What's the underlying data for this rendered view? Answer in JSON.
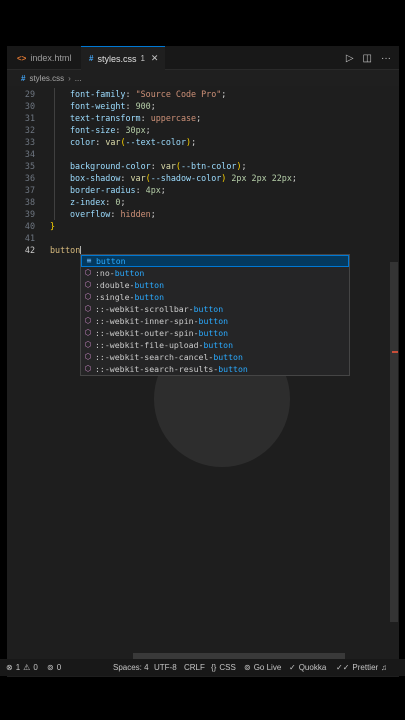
{
  "tabs": [
    {
      "label": "index.html",
      "icon": "html-icon",
      "active": false
    },
    {
      "label": "styles.css",
      "icon": "css-icon",
      "active": true,
      "problems": "1"
    }
  ],
  "breadcrumb": {
    "file": "styles.css",
    "symbol": "..."
  },
  "code_lines": [
    {
      "n": "29",
      "tokens": [
        [
          "p",
          "font-family"
        ],
        [
          "w",
          ": "
        ],
        [
          "v",
          "\"Source Code Pro\""
        ],
        [
          "w",
          ";"
        ]
      ]
    },
    {
      "n": "30",
      "tokens": [
        [
          "p",
          "font-weight"
        ],
        [
          "w",
          ": "
        ],
        [
          "n",
          "900"
        ],
        [
          "w",
          ";"
        ]
      ]
    },
    {
      "n": "31",
      "tokens": [
        [
          "p",
          "text-transform"
        ],
        [
          "w",
          ": "
        ],
        [
          "v",
          "uppercase"
        ],
        [
          "w",
          ";"
        ]
      ]
    },
    {
      "n": "32",
      "tokens": [
        [
          "p",
          "font-size"
        ],
        [
          "w",
          ": "
        ],
        [
          "n",
          "30px"
        ],
        [
          "w",
          ";"
        ]
      ]
    },
    {
      "n": "33",
      "tokens": [
        [
          "p",
          "color"
        ],
        [
          "w",
          ": "
        ],
        [
          "f",
          "var"
        ],
        [
          "b",
          "("
        ],
        [
          "p",
          "--text-color"
        ],
        [
          "b",
          ")"
        ],
        [
          "w",
          ";"
        ]
      ]
    },
    {
      "n": "34",
      "tokens": []
    },
    {
      "n": "35",
      "tokens": [
        [
          "p",
          "background-color"
        ],
        [
          "w",
          ": "
        ],
        [
          "f",
          "var"
        ],
        [
          "b",
          "("
        ],
        [
          "p",
          "--btn-color"
        ],
        [
          "b",
          ")"
        ],
        [
          "w",
          ";"
        ]
      ]
    },
    {
      "n": "36",
      "tokens": [
        [
          "p",
          "box-shadow"
        ],
        [
          "w",
          ": "
        ],
        [
          "f",
          "var"
        ],
        [
          "b",
          "("
        ],
        [
          "p",
          "--shadow-color"
        ],
        [
          "b",
          ")"
        ],
        [
          "w",
          " "
        ],
        [
          "n",
          "2px 2px 22px"
        ],
        [
          "w",
          ";"
        ]
      ]
    },
    {
      "n": "37",
      "tokens": [
        [
          "p",
          "border-radius"
        ],
        [
          "w",
          ": "
        ],
        [
          "n",
          "4px"
        ],
        [
          "w",
          ";"
        ]
      ]
    },
    {
      "n": "38",
      "tokens": [
        [
          "p",
          "z-index"
        ],
        [
          "w",
          ": "
        ],
        [
          "n",
          "0"
        ],
        [
          "w",
          ";"
        ]
      ]
    },
    {
      "n": "39",
      "tokens": [
        [
          "p",
          "overflow"
        ],
        [
          "w",
          ": "
        ],
        [
          "v",
          "hidden"
        ],
        [
          "w",
          ";"
        ]
      ]
    },
    {
      "n": "40",
      "tokens": [
        [
          "b",
          "}"
        ]
      ]
    },
    {
      "n": "41",
      "tokens": []
    },
    {
      "n": "42",
      "tokens": [
        [
          "sel",
          "button"
        ]
      ]
    }
  ],
  "suggestions": [
    {
      "pre": "",
      "match": "button",
      "post": ""
    },
    {
      "pre": ":no-",
      "match": "button",
      "post": ""
    },
    {
      "pre": ":double-",
      "match": "button",
      "post": ""
    },
    {
      "pre": ":single-",
      "match": "button",
      "post": ""
    },
    {
      "pre": "::-webkit-scrollbar-",
      "match": "button",
      "post": ""
    },
    {
      "pre": "::-webkit-inner-spin-",
      "match": "button",
      "post": ""
    },
    {
      "pre": "::-webkit-outer-spin-",
      "match": "button",
      "post": ""
    },
    {
      "pre": "::-webkit-file-upload-",
      "match": "button",
      "post": ""
    },
    {
      "pre": "::-webkit-search-cancel-",
      "match": "button",
      "post": ""
    },
    {
      "pre": "::-webkit-search-results-",
      "match": "button",
      "post": ""
    }
  ],
  "status": {
    "errors": "1",
    "warnings": "0",
    "ports": "0",
    "spaces": "Spaces: 4",
    "encoding": "UTF-8",
    "eol": "CRLF",
    "language": "CSS",
    "golive": "Go Live",
    "quokka": "Quokka",
    "prettier": "Prettier"
  }
}
